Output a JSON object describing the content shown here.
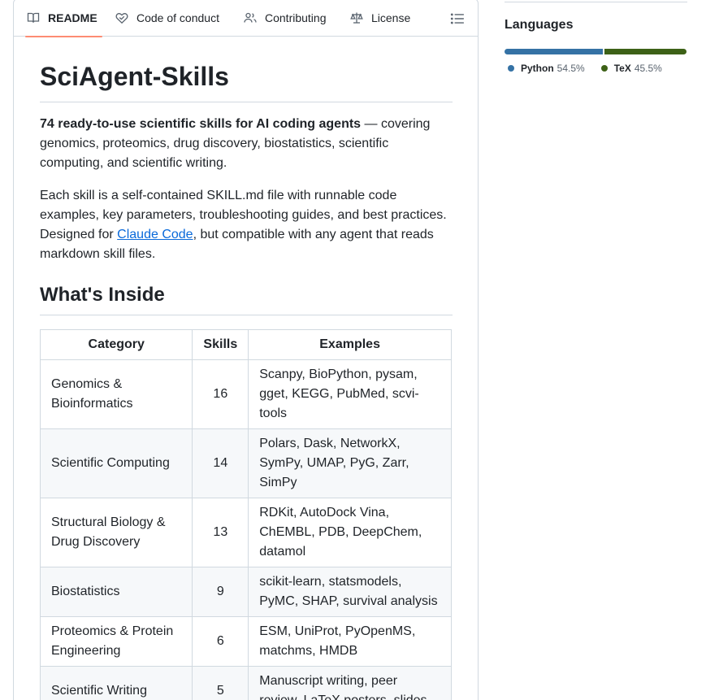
{
  "tabs": {
    "readme": "README",
    "conduct": "Code of conduct",
    "contributing": "Contributing",
    "license": "License"
  },
  "readme": {
    "title": "SciAgent-Skills",
    "intro_bold": "74 ready-to-use scientific skills for AI coding agents",
    "intro_rest": " — covering genomics, proteomics, drug discovery, biostatistics, scientific computing, and scientific writing.",
    "p2_before": "Each skill is a self-contained SKILL.md file with runnable code examples, key parameters, troubleshooting guides, and best practices. Designed for ",
    "p2_link": "Claude Code",
    "p2_after": ", but compatible with any agent that reads markdown skill files.",
    "section_heading": "What's Inside",
    "table": {
      "headers": [
        "Category",
        "Skills",
        "Examples"
      ],
      "rows": [
        {
          "category": "Genomics & Bioinformatics",
          "skills": "16",
          "examples": "Scanpy, BioPython, pysam, gget, KEGG, PubMed, scvi-tools"
        },
        {
          "category": "Scientific Computing",
          "skills": "14",
          "examples": "Polars, Dask, NetworkX, SymPy, UMAP, PyG, Zarr, SimPy"
        },
        {
          "category": "Structural Biology & Drug Discovery",
          "skills": "13",
          "examples": "RDKit, AutoDock Vina, ChEMBL, PDB, DeepChem, datamol"
        },
        {
          "category": "Biostatistics",
          "skills": "9",
          "examples": "scikit-learn, statsmodels, PyMC, SHAP, survival analysis"
        },
        {
          "category": "Proteomics & Protein Engineering",
          "skills": "6",
          "examples": "ESM, UniProt, PyOpenMS, matchms, HMDB"
        },
        {
          "category": "Scientific Writing",
          "skills": "5",
          "examples": "Manuscript writing, peer review, LaTeX posters, slides"
        }
      ]
    }
  },
  "sidebar": {
    "languages_title": "Languages",
    "languages": [
      {
        "name": "Python",
        "percent": "54.5%",
        "share": 54.5,
        "color": "#3572A5"
      },
      {
        "name": "TeX",
        "percent": "45.5%",
        "share": 45.5,
        "color": "#3D6117"
      }
    ]
  }
}
